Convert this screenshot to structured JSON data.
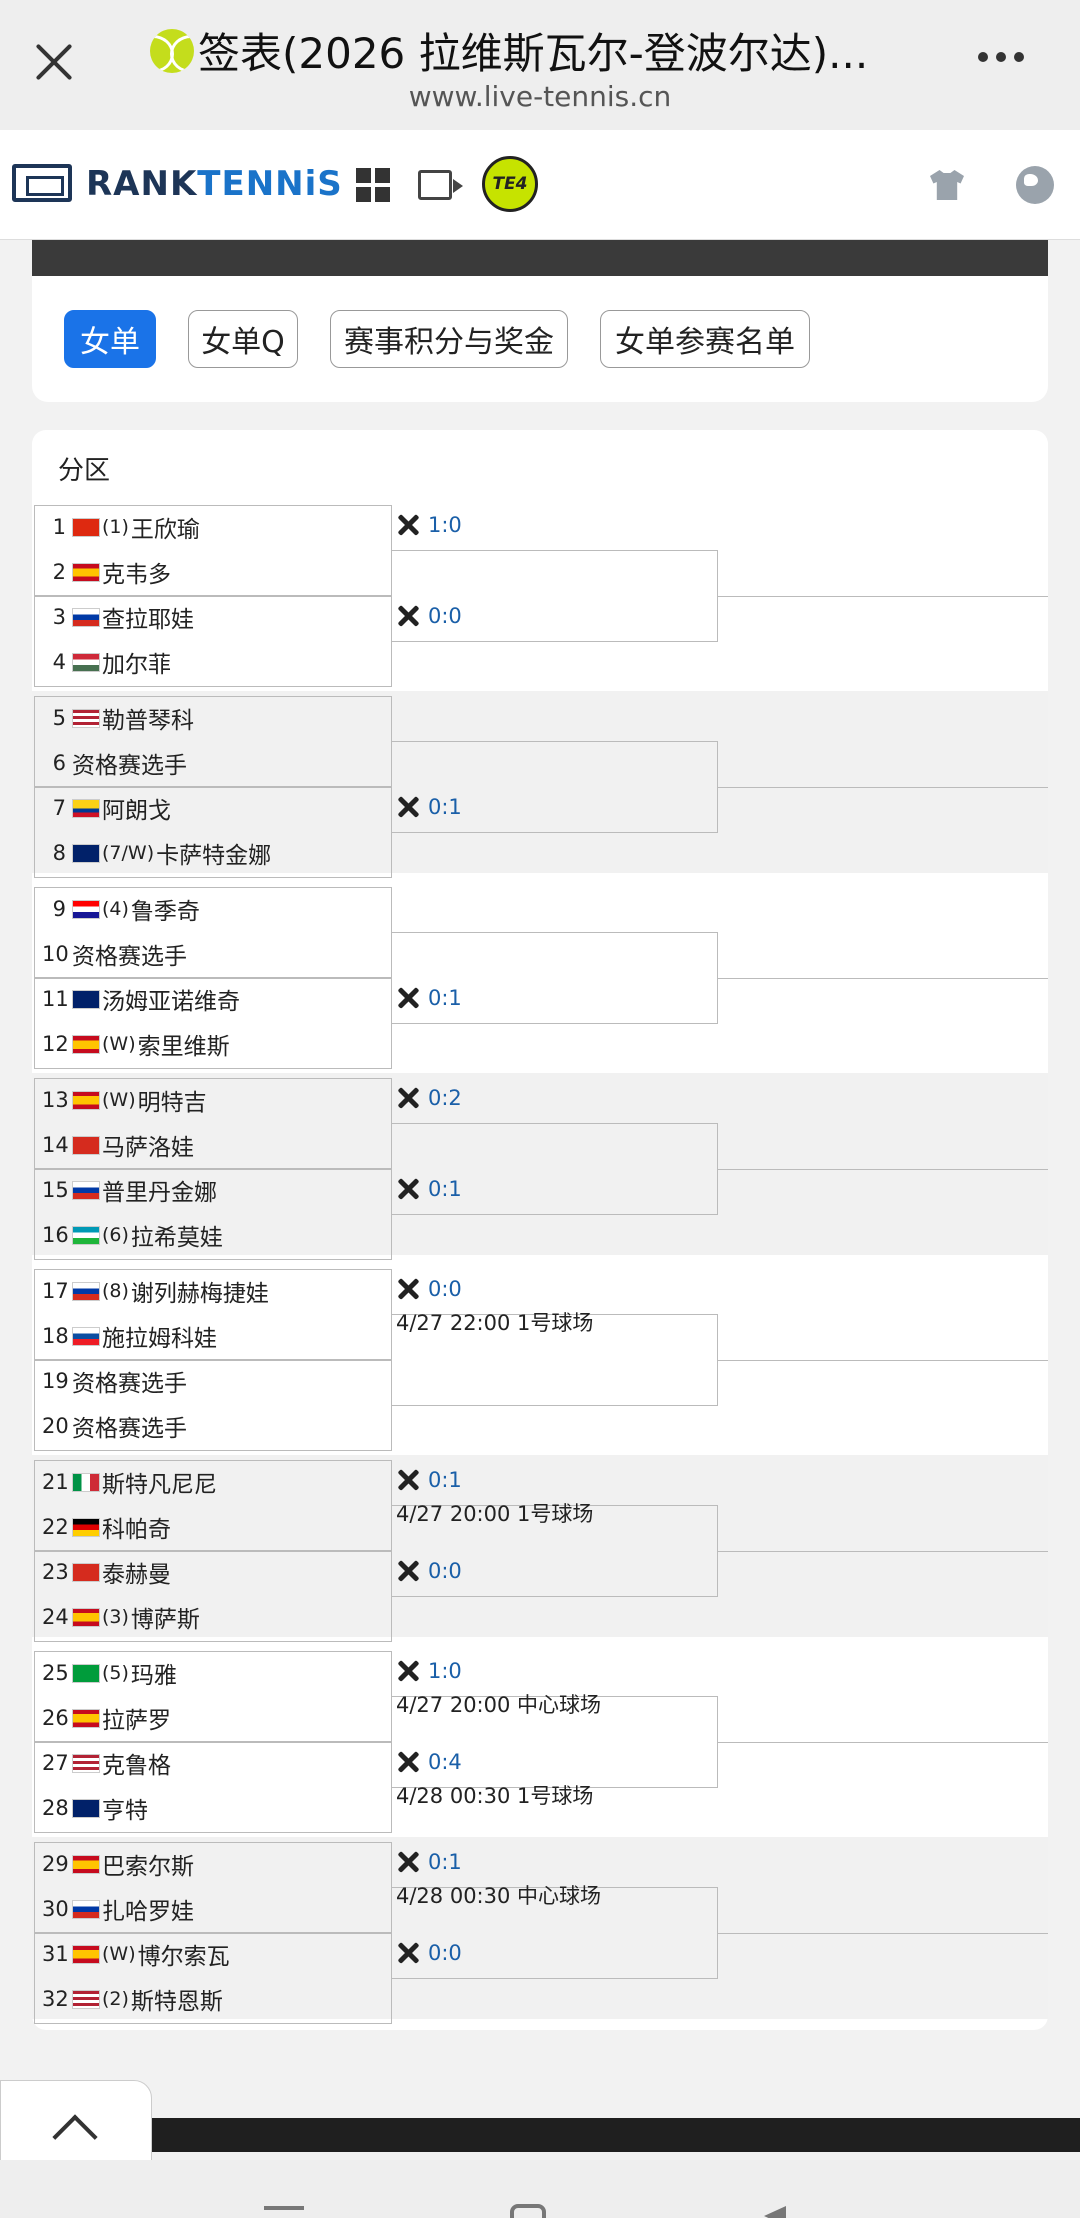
{
  "browser": {
    "title": "签表(2026 拉维斯瓦尔-登波尔达)...",
    "url": "www.live-tennis.cn"
  },
  "site": {
    "logo_prefix": "RANK",
    "logo_accent": "TENNiS",
    "badge": "TE4",
    "accent_color": "#1a73e8"
  },
  "tabs": [
    {
      "label": "女单",
      "active": true
    },
    {
      "label": "女单Q",
      "active": false
    },
    {
      "label": "赛事积分与奖金",
      "active": false
    },
    {
      "label": "女单参赛名单",
      "active": false
    }
  ],
  "draw": {
    "section_title": "分区",
    "players": [
      {
        "no": "1",
        "flag": "cn",
        "seed": "(1)",
        "name": "王欣瑜"
      },
      {
        "no": "2",
        "flag": "es",
        "seed": "",
        "name": "克韦多"
      },
      {
        "no": "3",
        "flag": "ru",
        "seed": "",
        "name": "查拉耶娃"
      },
      {
        "no": "4",
        "flag": "hu",
        "seed": "",
        "name": "加尔菲"
      },
      {
        "no": "5",
        "flag": "us",
        "seed": "",
        "name": "勒普琴科"
      },
      {
        "no": "6",
        "flag": "",
        "seed": "",
        "name": "资格赛选手"
      },
      {
        "no": "7",
        "flag": "co",
        "seed": "",
        "name": "阿朗戈"
      },
      {
        "no": "8",
        "flag": "au",
        "seed": "(7/W)",
        "name": "卡萨特金娜"
      },
      {
        "no": "9",
        "flag": "hr",
        "seed": "(4)",
        "name": "鲁季奇"
      },
      {
        "no": "10",
        "flag": "",
        "seed": "",
        "name": "资格赛选手"
      },
      {
        "no": "11",
        "flag": "au",
        "seed": "",
        "name": "汤姆亚诺维奇"
      },
      {
        "no": "12",
        "flag": "es",
        "seed": "(W)",
        "name": "索里维斯"
      },
      {
        "no": "13",
        "flag": "es",
        "seed": "(W)",
        "name": "明特吉"
      },
      {
        "no": "14",
        "flag": "ch",
        "seed": "",
        "name": "马萨洛娃"
      },
      {
        "no": "15",
        "flag": "ru",
        "seed": "",
        "name": "普里丹金娜"
      },
      {
        "no": "16",
        "flag": "uz",
        "seed": "(6)",
        "name": "拉希莫娃"
      },
      {
        "no": "17",
        "flag": "ru",
        "seed": "(8)",
        "name": "谢列赫梅捷娃"
      },
      {
        "no": "18",
        "flag": "sk",
        "seed": "",
        "name": "施拉姆科娃"
      },
      {
        "no": "19",
        "flag": "",
        "seed": "",
        "name": "资格赛选手"
      },
      {
        "no": "20",
        "flag": "",
        "seed": "",
        "name": "资格赛选手"
      },
      {
        "no": "21",
        "flag": "it",
        "seed": "",
        "name": "斯特凡尼尼"
      },
      {
        "no": "22",
        "flag": "de",
        "seed": "",
        "name": "科帕奇"
      },
      {
        "no": "23",
        "flag": "ch",
        "seed": "",
        "name": "泰赫曼"
      },
      {
        "no": "24",
        "flag": "es",
        "seed": "(3)",
        "name": "博萨斯"
      },
      {
        "no": "25",
        "flag": "br",
        "seed": "(5)",
        "name": "玛雅"
      },
      {
        "no": "26",
        "flag": "es",
        "seed": "",
        "name": "拉萨罗"
      },
      {
        "no": "27",
        "flag": "us",
        "seed": "",
        "name": "克鲁格"
      },
      {
        "no": "28",
        "flag": "au",
        "seed": "",
        "name": "亨特"
      },
      {
        "no": "29",
        "flag": "es",
        "seed": "",
        "name": "巴索尔斯"
      },
      {
        "no": "30",
        "flag": "ru",
        "seed": "",
        "name": "扎哈罗娃"
      },
      {
        "no": "31",
        "flag": "es",
        "seed": "(W)",
        "name": "博尔索瓦"
      },
      {
        "no": "32",
        "flag": "us",
        "seed": "(2)",
        "name": "斯特恩斯"
      }
    ],
    "matches": [
      {
        "h2h": "1:0",
        "schedule": ""
      },
      {
        "h2h": "0:0",
        "schedule": ""
      },
      {
        "h2h": "",
        "schedule": ""
      },
      {
        "h2h": "0:1",
        "schedule": ""
      },
      {
        "h2h": "",
        "schedule": ""
      },
      {
        "h2h": "0:1",
        "schedule": ""
      },
      {
        "h2h": "0:2",
        "schedule": ""
      },
      {
        "h2h": "0:1",
        "schedule": ""
      },
      {
        "h2h": "0:0",
        "schedule": "4/27 22:00 1号球场"
      },
      {
        "h2h": "",
        "schedule": ""
      },
      {
        "h2h": "0:1",
        "schedule": "4/27 20:00 1号球场"
      },
      {
        "h2h": "0:0",
        "schedule": ""
      },
      {
        "h2h": "1:0",
        "schedule": "4/27 20:00 中心球场"
      },
      {
        "h2h": "0:4",
        "schedule": "4/28 00:30 1号球场"
      },
      {
        "h2h": "0:1",
        "schedule": "4/28 00:30 中心球场"
      },
      {
        "h2h": "0:0",
        "schedule": ""
      }
    ]
  },
  "icons": {
    "close": "close-icon",
    "more": "more-icon",
    "grid": "grid-icon",
    "video": "video-icon",
    "shirt": "shirt-icon",
    "globe": "globe-icon",
    "h2h": "h2h-icon",
    "back_to_top": "chevron-up-icon"
  }
}
